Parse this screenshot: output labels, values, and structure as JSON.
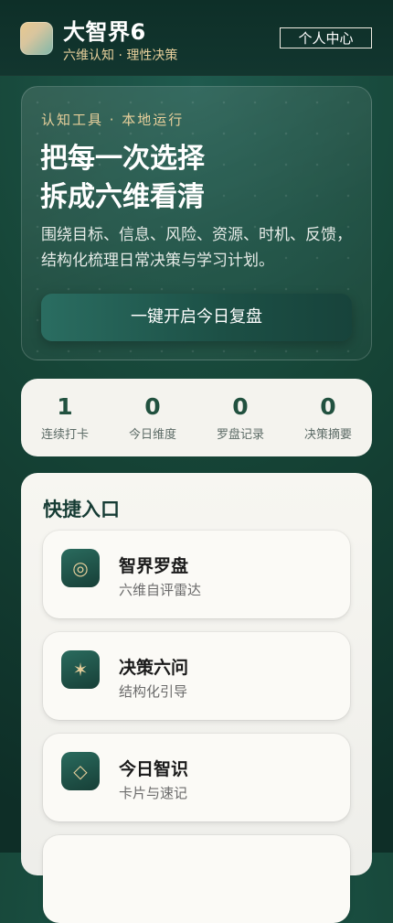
{
  "header": {
    "title": "大智界6",
    "subtitle": "六维认知 · 理性决策",
    "profile_button": "个人中心"
  },
  "hero": {
    "tag": "认知工具 · 本地运行",
    "title_line1": "把每一次选择",
    "title_line2": "拆成六维看清",
    "description": "围绕目标、信息、风险、资源、时机、反馈，结构化梳理日常决策与学习计划。",
    "button": "一键开启今日复盘"
  },
  "stats": [
    {
      "value": "1",
      "label": "连续打卡"
    },
    {
      "value": "0",
      "label": "今日维度"
    },
    {
      "value": "0",
      "label": "罗盘记录"
    },
    {
      "value": "0",
      "label": "决策摘要"
    }
  ],
  "quick": {
    "title": "快捷入口",
    "items": [
      {
        "icon": "compass-icon",
        "glyph": "◎",
        "title": "智界罗盘",
        "subtitle": "六维自评雷达"
      },
      {
        "icon": "star-icon",
        "glyph": "✶",
        "title": "决策六问",
        "subtitle": "结构化引导"
      },
      {
        "icon": "diamond-icon",
        "glyph": "◇",
        "title": "今日智识",
        "subtitle": "卡片与速记"
      }
    ]
  },
  "colors": {
    "accent_gold": "#e7cf9b",
    "brand_green": "#164537",
    "card_bg": "#f4f3ee"
  }
}
